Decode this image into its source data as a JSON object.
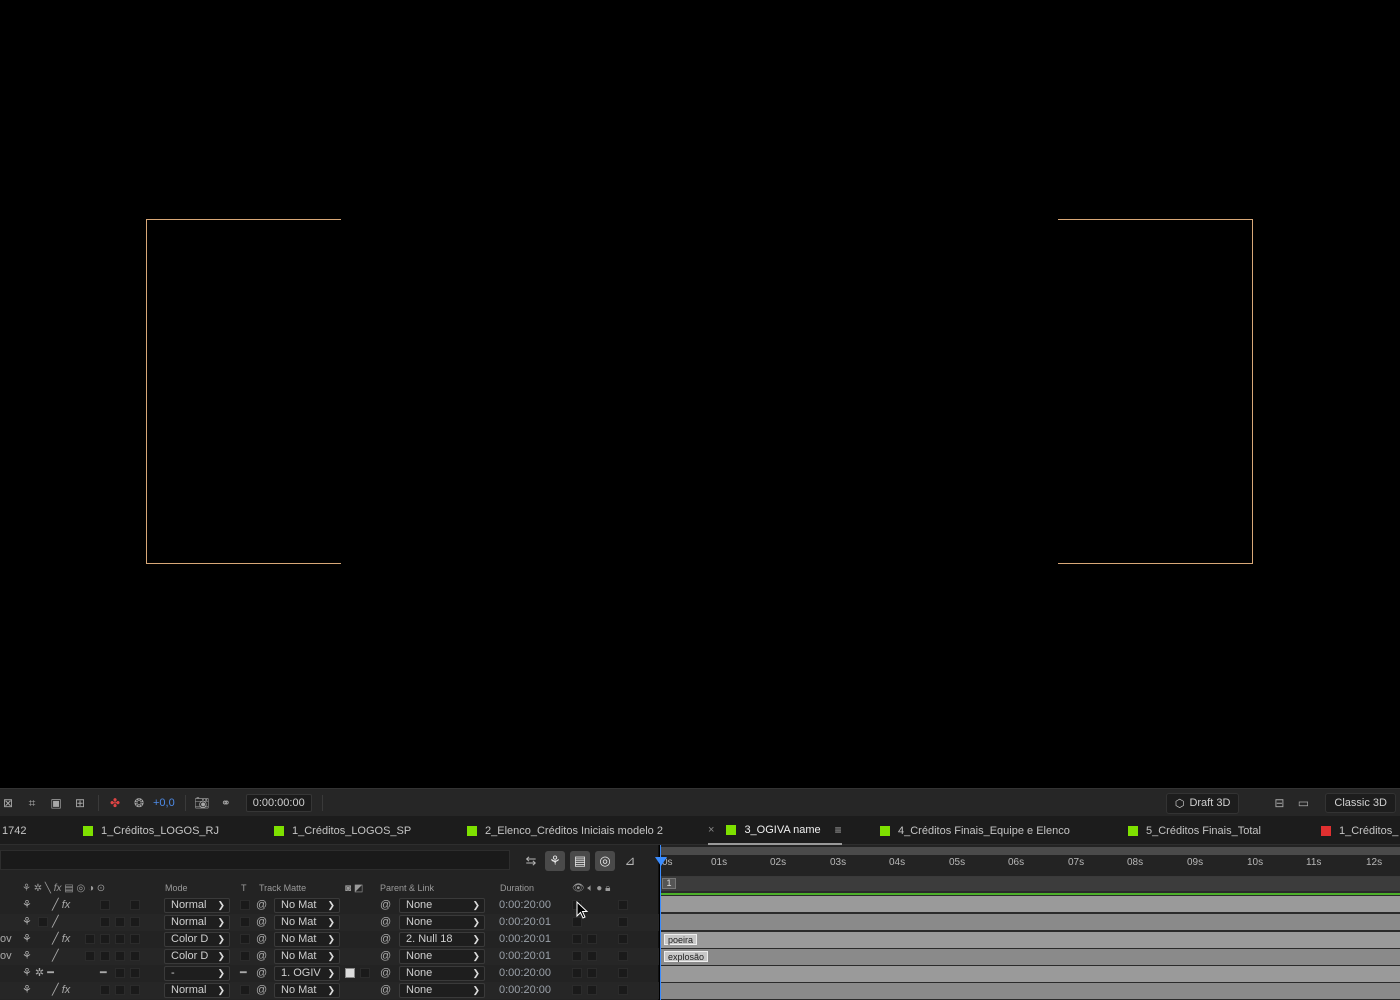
{
  "viewer": {
    "frame_color": "#d8a878"
  },
  "toolbar": {
    "offset_label": "+0,0",
    "timecode": "0:00:00:00",
    "draft3d_label": "Draft 3D",
    "renderer_label": "Classic 3D"
  },
  "tabs": [
    {
      "label": "1742",
      "color": ""
    },
    {
      "label": "1_Créditos_LOGOS_RJ",
      "color": "#7ee000"
    },
    {
      "label": "1_Créditos_LOGOS_SP",
      "color": "#7ee000"
    },
    {
      "label": "2_Elenco_Créditos Iniciais modelo 2",
      "color": "#7ee000"
    },
    {
      "label": "3_OGIVA name",
      "color": "#7ee000",
      "active": true
    },
    {
      "label": "4_Créditos Finais_Equipe e Elenco",
      "color": "#7ee000"
    },
    {
      "label": "5_Créditos Finais_Total",
      "color": "#7ee000"
    },
    {
      "label": "1_Créditos_",
      "color": "#e03030"
    }
  ],
  "columns": {
    "mode": "Mode",
    "t": "T",
    "track_matte": "Track Matte",
    "parent_link": "Parent & Link",
    "duration": "Duration"
  },
  "layers": [
    {
      "prefix": "",
      "mode": "Normal",
      "track_matte": "No Mat",
      "parent": "None",
      "duration": "0:00:20:00"
    },
    {
      "prefix": "",
      "mode": "Normal",
      "track_matte": "No Mat",
      "parent": "None",
      "duration": "0:00:20:01"
    },
    {
      "prefix": "ov",
      "mode": "Color D",
      "track_matte": "No Mat",
      "parent": "2. Null 18",
      "duration": "0:00:20:01"
    },
    {
      "prefix": "ov",
      "mode": "Color D",
      "track_matte": "No Mat",
      "parent": "None",
      "duration": "0:00:20:01"
    },
    {
      "prefix": "",
      "mode": "-",
      "track_matte": "1. OGIV",
      "parent": "None",
      "duration": "0:00:20:00"
    },
    {
      "prefix": "",
      "mode": "Normal",
      "track_matte": "No Mat",
      "parent": "None",
      "duration": "0:00:20:00"
    }
  ],
  "timeline": {
    "ticks": [
      "0s",
      "01s",
      "02s",
      "03s",
      "04s",
      "05s",
      "06s",
      "07s",
      "08s",
      "09s",
      "10s",
      "11s",
      "12s"
    ],
    "marker": "1",
    "bar_labels": {
      "row3": "poeira",
      "row4": "explosão"
    }
  }
}
